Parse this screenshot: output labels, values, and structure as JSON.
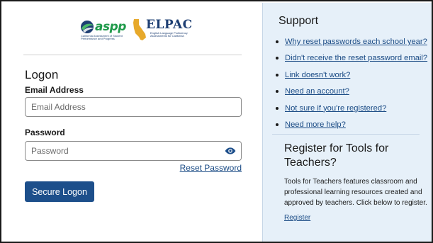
{
  "logos": {
    "caaspp_word": "aspp",
    "caaspp_subtitle": "California Assessment of Student Performance and Progress",
    "elpac_word": "ELPAC",
    "elpac_subtitle": "English Language Proficiency Assessments for California"
  },
  "logon": {
    "title": "Logon",
    "email_label": "Email Address",
    "email_placeholder": "Email Address",
    "email_value": "",
    "password_label": "Password",
    "password_placeholder": "Password",
    "password_value": "",
    "reset_link": "Reset Password",
    "submit_label": "Secure Logon"
  },
  "support": {
    "title": "Support",
    "links": [
      "Why reset passwords each school year?",
      "Didn't receive the reset password email?",
      "Link doesn't work?",
      "Need an account?",
      "Not sure if you're registered?",
      "Need more help?"
    ]
  },
  "register": {
    "title": "Register for Tools for Teachers?",
    "description": "Tools for Teachers features classroom and professional learning resources created and approved by teachers. Click below to register.",
    "link": "Register"
  },
  "colors": {
    "primary_button": "#1d4f8b",
    "link": "#1a4b85",
    "support_panel_bg": "#e6f0f9",
    "caaspp_green": "#1f9a4a",
    "elpac_navy": "#1e3f73",
    "elpac_gold": "#e7a92b"
  },
  "icons": {
    "password_toggle": "eye-icon",
    "caaspp_mark": "caaspp-swirl-icon",
    "elpac_mark": "california-map-icon"
  }
}
